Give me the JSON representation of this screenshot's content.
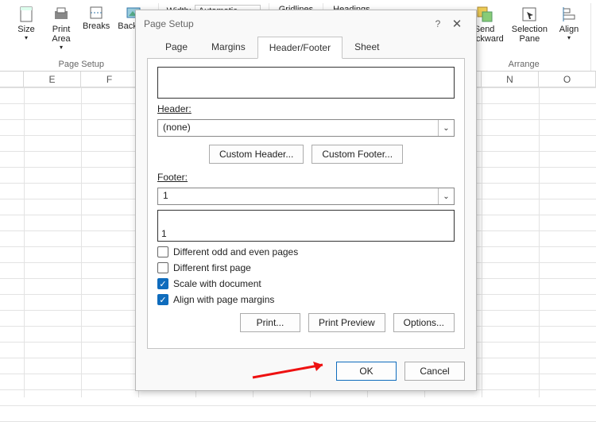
{
  "ribbon": {
    "size": "Size",
    "print_area": "Print\nArea",
    "breaks": "Breaks",
    "background": "Backgro",
    "width_label": "Width:",
    "width_value": "Automatic",
    "gridlines": "Gridlines",
    "headings": "Headings",
    "send_backward": "Send\nBackward",
    "selection_pane": "Selection\nPane",
    "align": "Align",
    "group_page_setup": "Page Setup",
    "group_arrange": "Arrange"
  },
  "columns": [
    "E",
    "F",
    "",
    "",
    "",
    "",
    "",
    "",
    "N",
    "O"
  ],
  "dialog": {
    "title": "Page Setup",
    "help": "?",
    "close": "✕",
    "tabs": {
      "page": "Page",
      "margins": "Margins",
      "hf": "Header/Footer",
      "sheet": "Sheet"
    },
    "header_label": "Header:",
    "header_value": "(none)",
    "custom_header": "Custom Header...",
    "custom_footer": "Custom Footer...",
    "footer_label": "Footer:",
    "footer_value": "1",
    "footer_preview": "1",
    "chk_oddeven": "Different odd and even pages",
    "chk_firstpage": "Different first page",
    "chk_scale": "Scale with document",
    "chk_align": "Align with page margins",
    "print": "Print...",
    "print_preview": "Print Preview",
    "options": "Options...",
    "ok": "OK",
    "cancel": "Cancel"
  }
}
